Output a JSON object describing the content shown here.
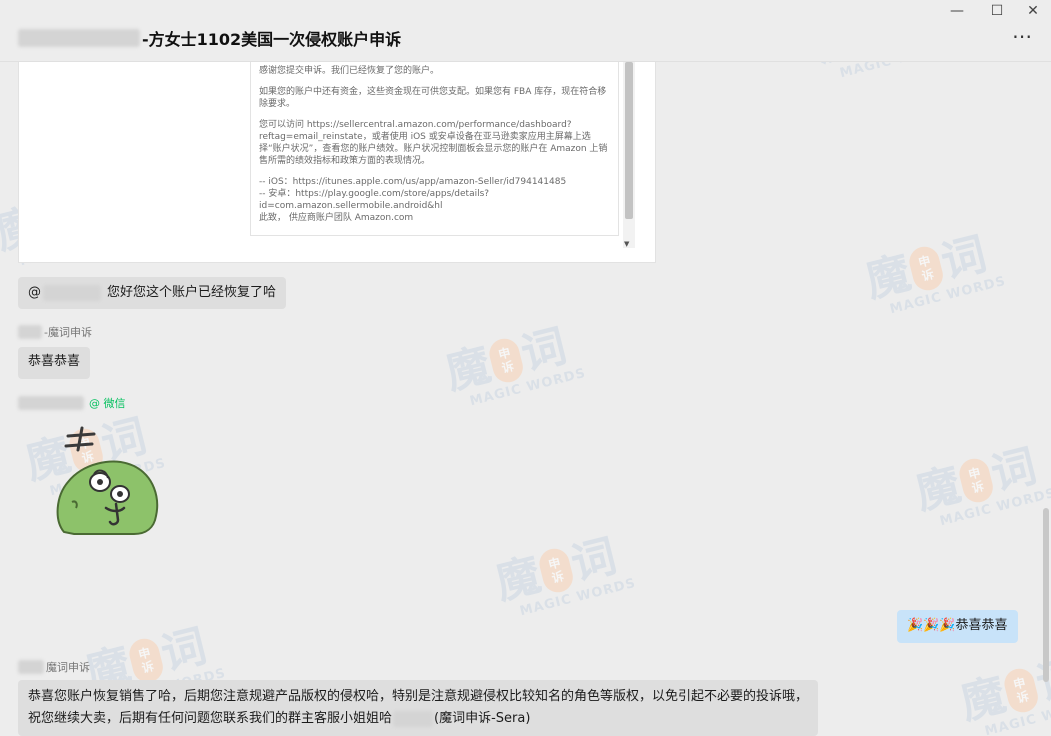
{
  "window": {
    "title": "-方女士1102美国一次侵权账户申诉",
    "minimize_glyph": "—",
    "maximize_glyph": "☐",
    "close_glyph": "✕",
    "more_glyph": "⋯"
  },
  "email": {
    "paragraphs": [
      "感谢您提交申诉。我们已经恢复了您的账户。",
      "如果您的账户中还有资金，这些资金现在可供您支配。如果您有 FBA 库存，现在符合移除要求。",
      "您可以访问 https://sellercentral.amazon.com/performance/dashboard?reftag=email_reinstate，或者使用 iOS 或安卓设备在亚马逊卖家应用主屏幕上选择“账户状况”，查看您的账户绩效。账户状况控制面板会显示您的账户在 Amazon 上销售所需的绩效指标和政策方面的表现情况。",
      "-- iOS：https://itunes.apple.com/us/app/amazon-Seller/id794141485\n-- 安卓：https://play.google.com/store/apps/details?id=com.amazon.sellermobile.android&hl\n此致，  供应商账户团队 Amazon.com"
    ]
  },
  "messages": {
    "m1": {
      "prefix": "@",
      "text": "您好您这个账户已经恢复了哈"
    },
    "m2": {
      "sender": "-魔词申诉",
      "text": "恭喜恭喜"
    },
    "m3": {
      "sender_tag": "@ 微信",
      "sticker_icon": "cartoon-green-blob-sticker"
    },
    "m4": {
      "text": "🎉🎉🎉恭喜恭喜"
    },
    "m5": {
      "sender": "魔词申诉",
      "line1": "恭喜您账户恢复销售了哈，后期您注意规避产品版权的侵权哈，特别是注意规避侵权比较知名的角色等版权，以免引起不必要的投诉哦，",
      "line2_a": "祝您继续大卖，后期有任何问题您联系我们的群主客服小姐姐哈",
      "line2_b": "(魔词申诉-Sera)"
    }
  },
  "watermark": {
    "char1": "魔",
    "seal_top": "申",
    "seal_bottom": "诉",
    "char2": "词",
    "text": "MAGIC WORDS"
  },
  "colors": {
    "background": "#ededed",
    "bubble_other": "#dedede",
    "bubble_self": "#c8e3f9",
    "wechat_green": "#07c160"
  }
}
